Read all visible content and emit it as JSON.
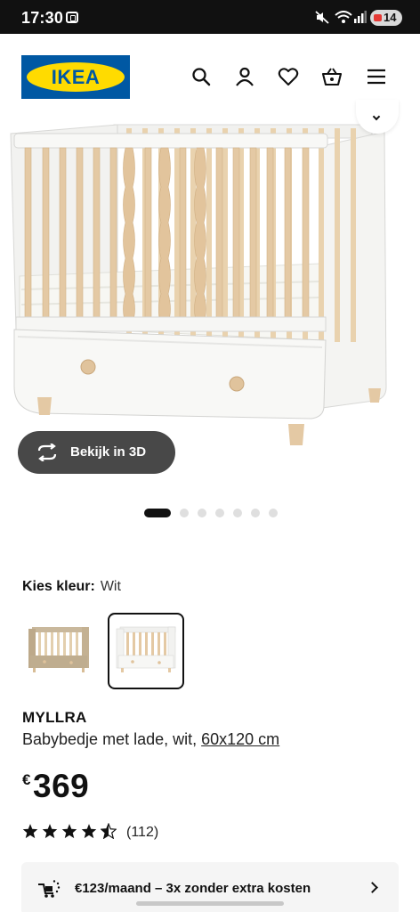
{
  "status_bar": {
    "time": "17:30",
    "battery": "14",
    "icons": [
      "screen-record-icon",
      "mute-icon",
      "wifi-icon",
      "signal-icon",
      "battery-icon"
    ]
  },
  "header": {
    "brand": "IKEA",
    "icons": [
      "search-icon",
      "account-icon",
      "wishlist-heart-icon",
      "shopping-bag-icon",
      "menu-icon"
    ]
  },
  "gallery": {
    "view_3d_label": "Bekijk in 3D",
    "image_count": 7,
    "active_index": 0
  },
  "color_picker": {
    "label": "Kies kleur:",
    "selected_value": "Wit",
    "options": [
      "beige",
      "white"
    ],
    "selected_index": 1
  },
  "product": {
    "name": "MYLLRA",
    "description": "Babybedje met lade, wit,",
    "size": "60x120 cm",
    "currency": "€",
    "price": "369",
    "rating": 4.5,
    "review_count": "(112)"
  },
  "finance_banner": {
    "text": "€123/maand – 3x zonder extra kosten"
  },
  "colors": {
    "ikea_blue": "#0058a3",
    "ikea_yellow": "#ffdb00",
    "wood": "#e4c9a4",
    "crib_white": "#f4f4f2"
  }
}
